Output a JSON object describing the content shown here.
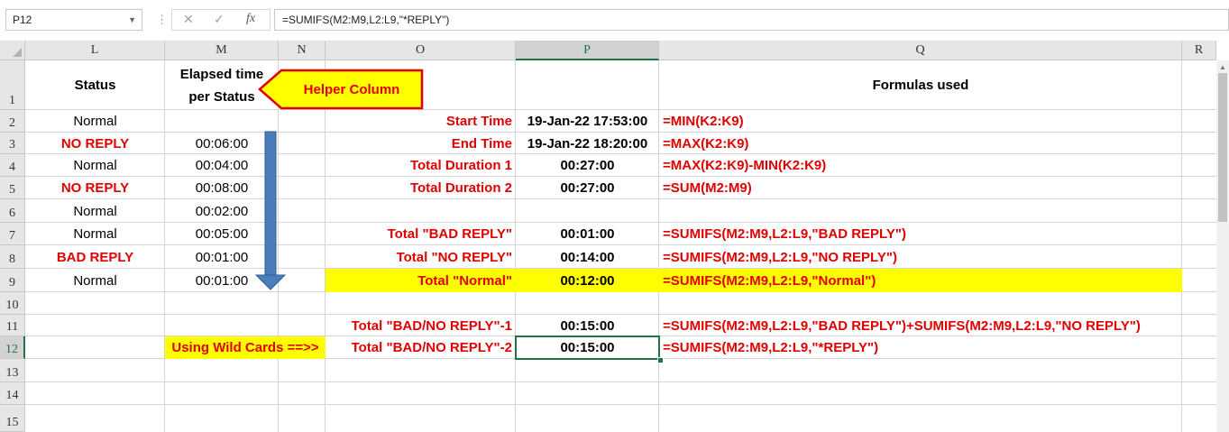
{
  "formula_bar": {
    "name_box": "P12",
    "cancel_icon": "✕",
    "enter_icon": "✓",
    "fx_label": "fx",
    "formula": "=SUMIFS(M2:M9,L2:L9,\"*REPLY\")"
  },
  "columns": [
    "L",
    "M",
    "N",
    "O",
    "P",
    "Q",
    "R"
  ],
  "rows": [
    "1",
    "2",
    "3",
    "4",
    "5",
    "6",
    "7",
    "8",
    "9",
    "10",
    "11",
    "12",
    "13",
    "14",
    "15"
  ],
  "headers": {
    "status": "Status",
    "elapsed_line1": "Elapsed time",
    "elapsed_line2": "per Status",
    "formulas_used": "Formulas used"
  },
  "callout": {
    "helper_column": "Helper Column"
  },
  "status_values": [
    "Normal",
    "NO REPLY",
    "Normal",
    "NO REPLY",
    "Normal",
    "Normal",
    "BAD REPLY",
    "Normal"
  ],
  "elapsed_values": [
    "00:06:00",
    "00:04:00",
    "00:08:00",
    "00:02:00",
    "00:05:00",
    "00:01:00",
    "00:01:00"
  ],
  "labels": {
    "start_time": "Start Time",
    "end_time": "End Time",
    "total_duration_1": "Total Duration 1",
    "total_duration_2": "Total Duration 2",
    "total_bad_reply": "Total \"BAD REPLY\"",
    "total_no_reply": "Total \"NO REPLY\"",
    "total_normal": "Total \"Normal\"",
    "total_bad_no_1": "Total \"BAD/NO REPLY\"-1",
    "total_bad_no_2": "Total \"BAD/NO REPLY\"-2",
    "wild_cards": "Using Wild Cards ==>>"
  },
  "values": {
    "start_time": "19-Jan-22 17:53:00",
    "end_time": "19-Jan-22 18:20:00",
    "total_duration_1": "00:27:00",
    "total_duration_2": "00:27:00",
    "total_bad_reply": "00:01:00",
    "total_no_reply": "00:14:00",
    "total_normal": "00:12:00",
    "total_bad_no_1": "00:15:00",
    "total_bad_no_2": "00:15:00"
  },
  "formulas": {
    "start_time": "=MIN(K2:K9)",
    "end_time": "=MAX(K2:K9)",
    "total_duration_1": "=MAX(K2:K9)-MIN(K2:K9)",
    "total_duration_2": "=SUM(M2:M9)",
    "total_bad_reply": "=SUMIFS(M2:M9,L2:L9,\"BAD REPLY\")",
    "total_no_reply": "=SUMIFS(M2:M9,L2:L9,\"NO REPLY\")",
    "total_normal": "=SUMIFS(M2:M9,L2:L9,\"Normal\")",
    "total_bad_no_1": "=SUMIFS(M2:M9,L2:L9,\"BAD REPLY\")+SUMIFS(M2:M9,L2:L9,\"NO REPLY\")",
    "total_bad_no_2": "=SUMIFS(M2:M9,L2:L9,\"*REPLY\")"
  },
  "colors": {
    "red": "#e00000",
    "yellow": "#ffff00",
    "selection": "#217346",
    "arrow": "#4a7ebb"
  },
  "icons": [
    "cancel-icon",
    "enter-icon",
    "fx-icon",
    "down-arrow-icon"
  ]
}
